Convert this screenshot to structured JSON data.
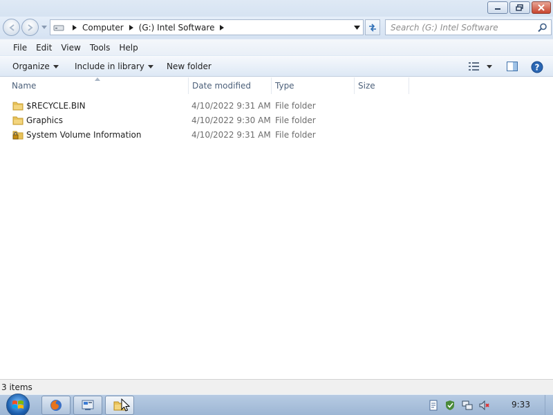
{
  "window": {
    "minimize_icon": "minimize-icon",
    "maximize_icon": "restore-icon",
    "close_icon": "close-icon"
  },
  "address_bar": {
    "drive_icon": "drive-icon",
    "breadcrumbs": [
      "Computer",
      "(G:) Intel Software"
    ]
  },
  "search": {
    "placeholder": "Search (G:) Intel Software"
  },
  "menu": {
    "items": [
      "File",
      "Edit",
      "View",
      "Tools",
      "Help"
    ]
  },
  "toolbar": {
    "organize_label": "Organize",
    "include_label": "Include in library",
    "new_folder_label": "New folder"
  },
  "columns": {
    "name": "Name",
    "date": "Date modified",
    "type": "Type",
    "size": "Size"
  },
  "files": [
    {
      "name": "$RECYCLE.BIN",
      "date": "4/10/2022 9:31 AM",
      "type": "File folder",
      "icon": "folder-icon"
    },
    {
      "name": "Graphics",
      "date": "4/10/2022 9:30 AM",
      "type": "File folder",
      "icon": "folder-icon"
    },
    {
      "name": "System Volume Information",
      "date": "4/10/2022 9:31 AM",
      "type": "File folder",
      "icon": "locked-folder-icon"
    }
  ],
  "status": {
    "items_count": "3 items"
  },
  "taskbar": {
    "clock": "9:33",
    "apps": [
      "firefox-icon",
      "app-icon",
      "explorer-icon"
    ]
  },
  "colors": {
    "accent": "#1c5fae",
    "folder": "#e8c25a"
  }
}
